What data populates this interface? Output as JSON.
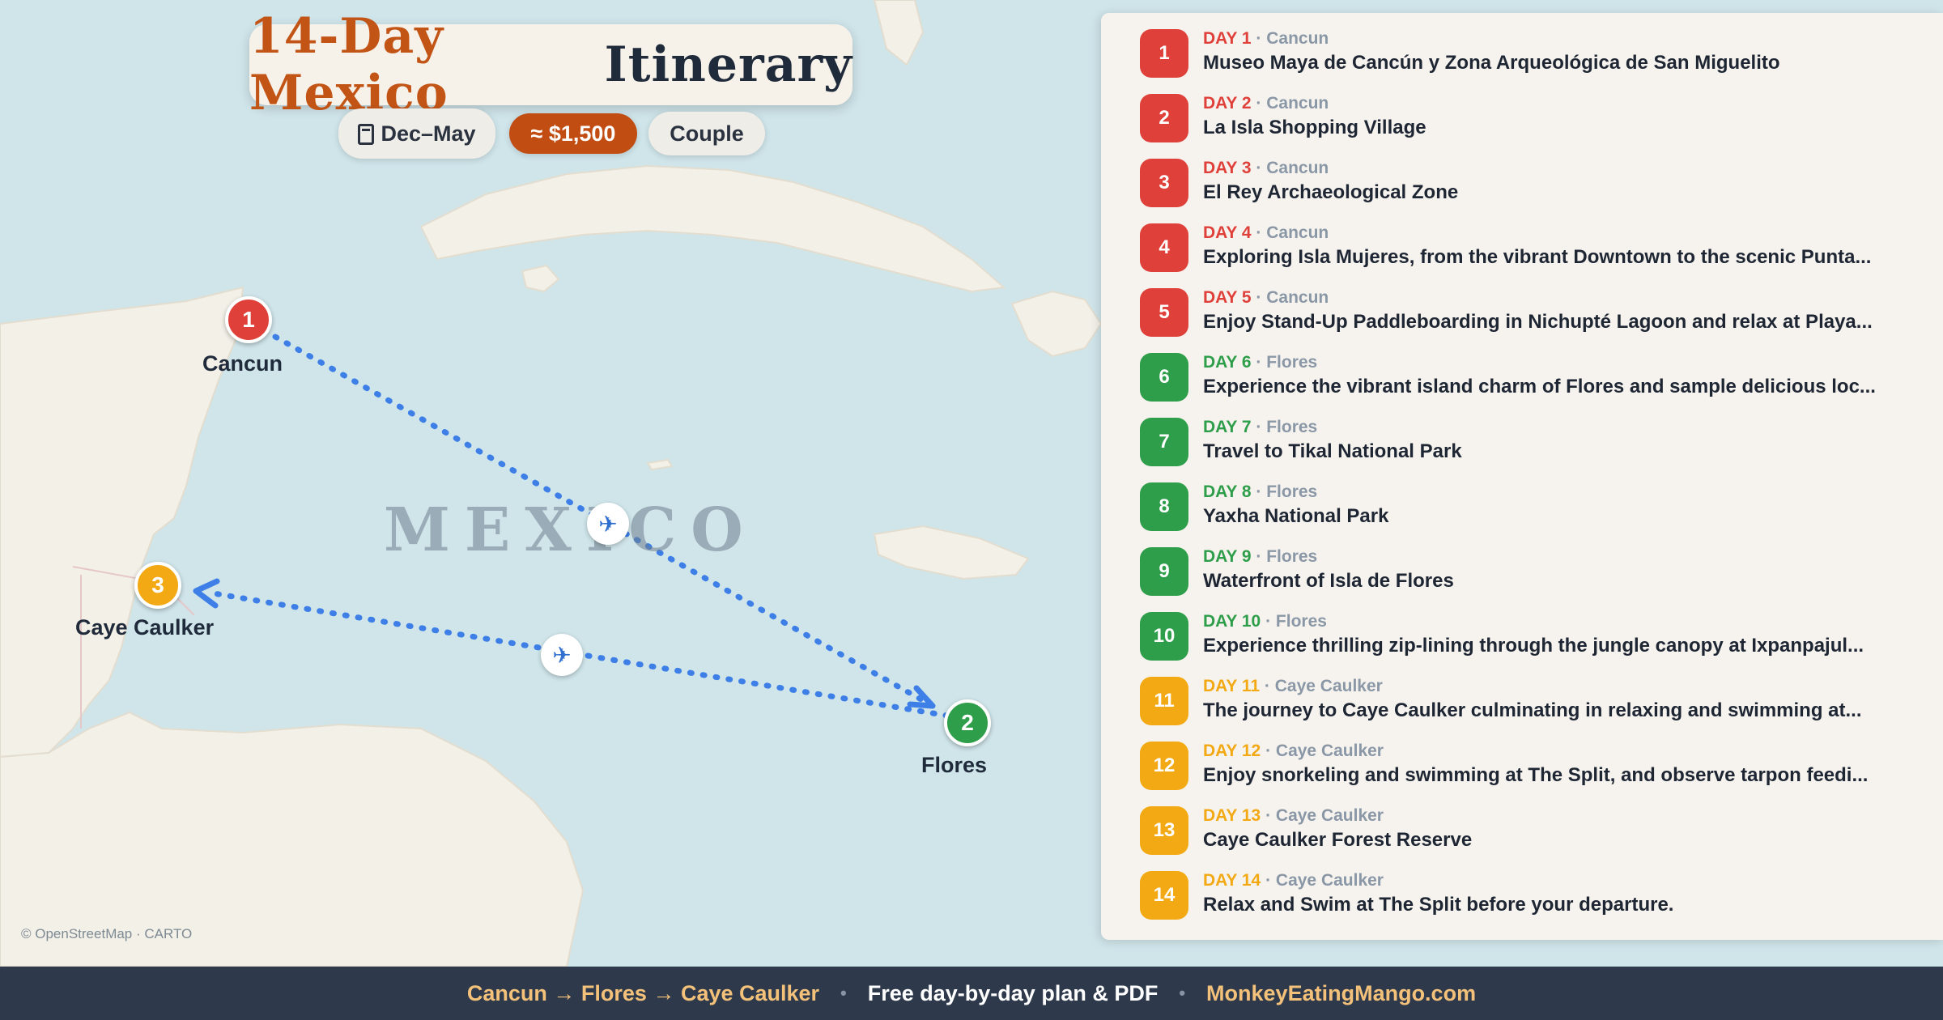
{
  "title": {
    "part1": "14-Day Mexico",
    "part2": "Itinerary"
  },
  "pills": {
    "season": "Dec–May",
    "budget": "≈ $1,500",
    "traveler": "Couple"
  },
  "map": {
    "country_label": "MEXICO",
    "attribution": "© OpenStreetMap · CARTO",
    "stops": [
      {
        "number": "1",
        "name": "Cancun",
        "color": "#e0403a"
      },
      {
        "number": "2",
        "name": "Flores",
        "color": "#2e9e4a"
      },
      {
        "number": "3",
        "name": "Caye Caulker",
        "color": "#f2a913"
      }
    ],
    "route_color": "#3d7fe6",
    "plane_icon": "airplane-icon"
  },
  "itinerary": [
    {
      "num": "1",
      "day": "DAY 1",
      "loc": "Cancun",
      "title": "Museo Maya de Cancún y Zona Arqueológica de San Miguelito",
      "color": "#e0403a"
    },
    {
      "num": "2",
      "day": "DAY 2",
      "loc": "Cancun",
      "title": "La Isla Shopping Village",
      "color": "#e0403a"
    },
    {
      "num": "3",
      "day": "DAY 3",
      "loc": "Cancun",
      "title": "El Rey Archaeological Zone",
      "color": "#e0403a"
    },
    {
      "num": "4",
      "day": "DAY 4",
      "loc": "Cancun",
      "title": "Exploring Isla Mujeres, from the vibrant Downtown to the scenic Punta...",
      "color": "#e0403a"
    },
    {
      "num": "5",
      "day": "DAY 5",
      "loc": "Cancun",
      "title": "Enjoy Stand-Up Paddleboarding in Nichupté Lagoon and relax at Playa...",
      "color": "#e0403a"
    },
    {
      "num": "6",
      "day": "DAY 6",
      "loc": "Flores",
      "title": "Experience the vibrant island charm of Flores and sample delicious loc...",
      "color": "#2e9e4a"
    },
    {
      "num": "7",
      "day": "DAY 7",
      "loc": "Flores",
      "title": "Travel to Tikal National Park",
      "color": "#2e9e4a"
    },
    {
      "num": "8",
      "day": "DAY 8",
      "loc": "Flores",
      "title": "Yaxha National Park",
      "color": "#2e9e4a"
    },
    {
      "num": "9",
      "day": "DAY 9",
      "loc": "Flores",
      "title": "Waterfront of Isla de Flores",
      "color": "#2e9e4a"
    },
    {
      "num": "10",
      "day": "DAY 10",
      "loc": "Flores",
      "title": "Experience thrilling zip-lining through the jungle canopy at Ixpanpajul...",
      "color": "#2e9e4a"
    },
    {
      "num": "11",
      "day": "DAY 11",
      "loc": "Caye Caulker",
      "title": "The journey to Caye Caulker culminating in relaxing and swimming at...",
      "color": "#f2a913"
    },
    {
      "num": "12",
      "day": "DAY 12",
      "loc": "Caye Caulker",
      "title": "Enjoy snorkeling and swimming at The Split, and observe tarpon feedi...",
      "color": "#f2a913"
    },
    {
      "num": "13",
      "day": "DAY 13",
      "loc": "Caye Caulker",
      "title": "Caye Caulker Forest Reserve",
      "color": "#f2a913"
    },
    {
      "num": "14",
      "day": "DAY 14",
      "loc": "Caye Caulker",
      "title": "Relax and Swim at The Split before your departure.",
      "color": "#f2a913"
    }
  ],
  "footer": {
    "route": "Cancun → Flores → Caye Caulker",
    "separator": "•",
    "plan": "Free day-by-day plan & PDF",
    "site": "MonkeyEatingMango.com"
  }
}
